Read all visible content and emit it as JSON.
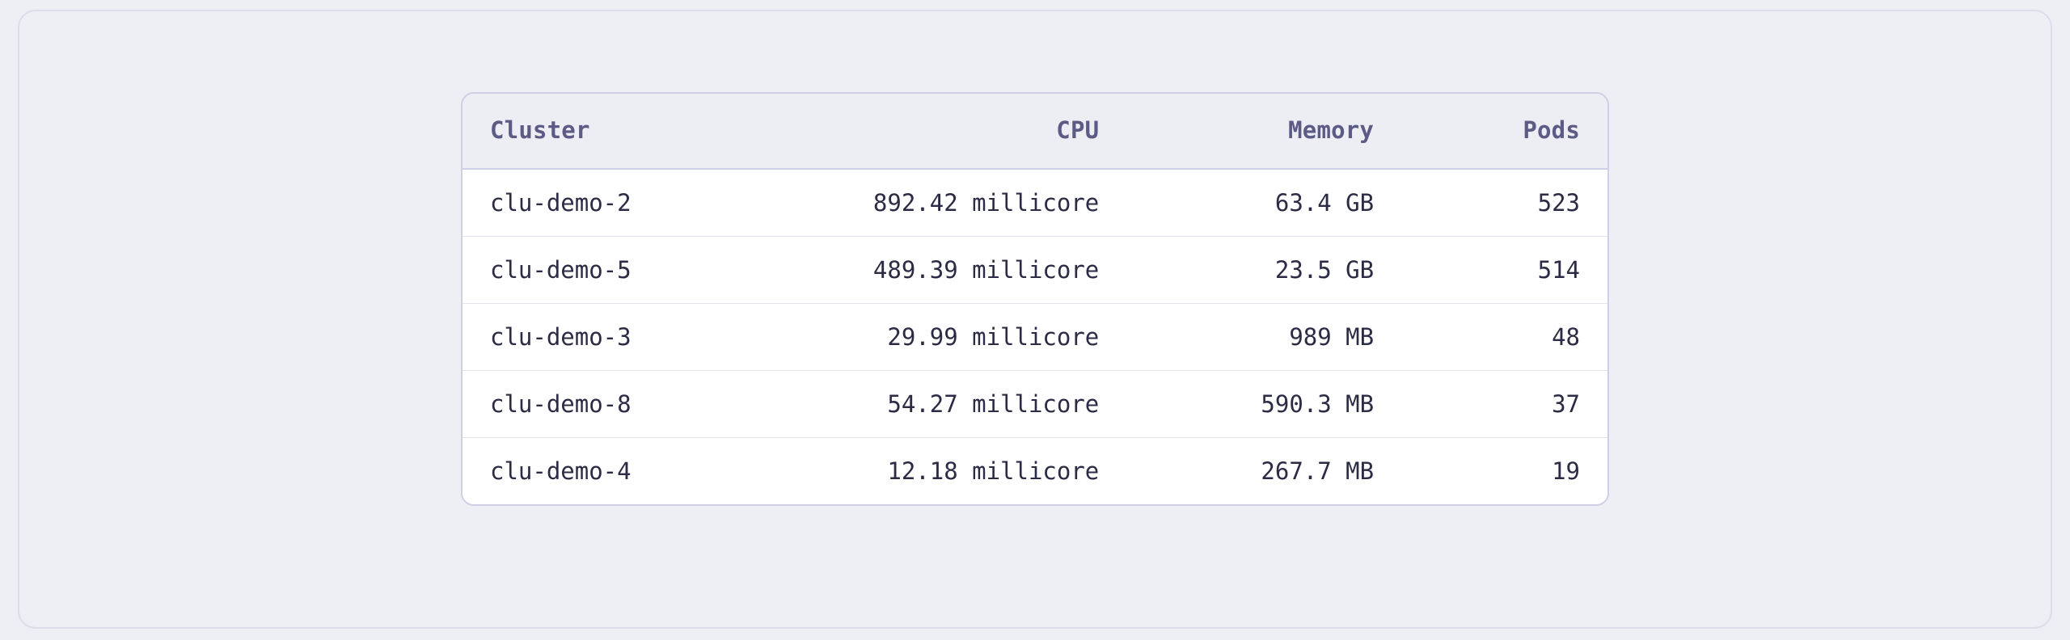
{
  "table": {
    "headers": {
      "cluster": "Cluster",
      "cpu": "CPU",
      "memory": "Memory",
      "pods": "Pods"
    },
    "rows": [
      {
        "cluster": "clu-demo-2",
        "cpu": "892.42 millicore",
        "memory": "63.4 GB",
        "pods": "523"
      },
      {
        "cluster": "clu-demo-5",
        "cpu": "489.39 millicore",
        "memory": "23.5 GB",
        "pods": "514"
      },
      {
        "cluster": "clu-demo-3",
        "cpu": "29.99 millicore",
        "memory": "989 MB",
        "pods": "48"
      },
      {
        "cluster": "clu-demo-8",
        "cpu": "54.27 millicore",
        "memory": "590.3 MB",
        "pods": "37"
      },
      {
        "cluster": "clu-demo-4",
        "cpu": "12.18 millicore",
        "memory": "267.7 MB",
        "pods": "19"
      }
    ]
  },
  "chart_data": {
    "type": "table",
    "title": "",
    "columns": [
      "Cluster",
      "CPU",
      "Memory",
      "Pods"
    ],
    "rows": [
      {
        "Cluster": "clu-demo-2",
        "CPU_millicore": 892.42,
        "Memory_MB": 63400,
        "Pods": 523
      },
      {
        "Cluster": "clu-demo-5",
        "CPU_millicore": 489.39,
        "Memory_MB": 23500,
        "Pods": 514
      },
      {
        "Cluster": "clu-demo-3",
        "CPU_millicore": 29.99,
        "Memory_MB": 989,
        "Pods": 48
      },
      {
        "Cluster": "clu-demo-8",
        "CPU_millicore": 54.27,
        "Memory_MB": 590.3,
        "Pods": 37
      },
      {
        "Cluster": "clu-demo-4",
        "CPU_millicore": 12.18,
        "Memory_MB": 267.7,
        "Pods": 19
      }
    ]
  }
}
